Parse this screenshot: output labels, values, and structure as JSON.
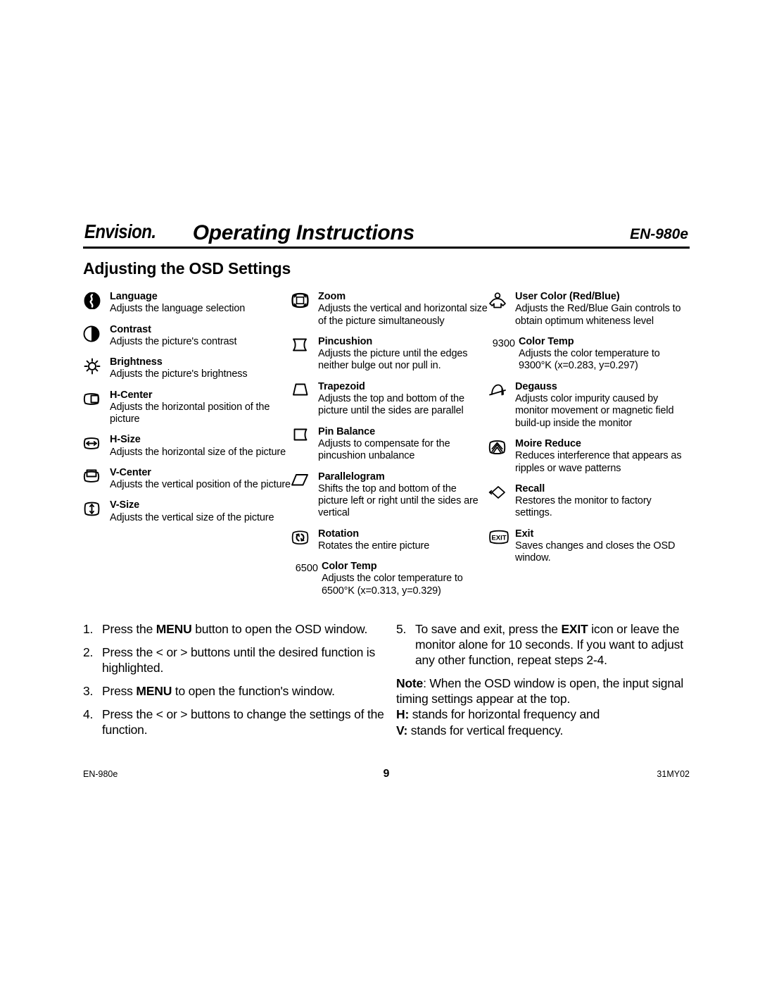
{
  "header": {
    "logo": "Envision",
    "title": "Operating Instructions",
    "model": "EN-980e"
  },
  "section_title": "Adjusting the OSD Settings",
  "columns": [
    {
      "id": "column-1",
      "entries": [
        {
          "icon": "language-globe-icon",
          "title": "Language",
          "desc": "Adjusts the language selection"
        },
        {
          "icon": "contrast-half-circle-icon",
          "title": "Contrast",
          "desc": "Adjusts the picture's contrast"
        },
        {
          "icon": "brightness-sun-icon",
          "title": "Brightness",
          "desc": "Adjusts the picture's brightness"
        },
        {
          "icon": "h-center-icon",
          "title": "H-Center",
          "desc": "Adjusts the horizontal position of the picture"
        },
        {
          "icon": "h-size-icon",
          "title": "H-Size",
          "desc": "Adjusts the horizontal size of the picture"
        },
        {
          "icon": "v-center-icon",
          "title": "V-Center",
          "desc": "Adjusts the vertical position of the picture"
        },
        {
          "icon": "v-size-icon",
          "title": "V-Size",
          "desc": "Adjusts the vertical size of the picture"
        }
      ]
    },
    {
      "id": "column-2",
      "entries": [
        {
          "icon": "zoom-icon",
          "title": "Zoom",
          "desc": "Adjusts the vertical and horizontal size of the picture simultaneously"
        },
        {
          "icon": "pincushion-icon",
          "title": "Pincushion",
          "desc": "Adjusts the picture until the edges neither bulge out nor pull in."
        },
        {
          "icon": "trapezoid-icon",
          "title": "Trapezoid",
          "desc": "Adjusts the top and bottom of the picture until the sides are parallel"
        },
        {
          "icon": "pin-balance-icon",
          "title": "Pin Balance",
          "desc": "Adjusts to compensate for the pincushion unbalance"
        },
        {
          "icon": "parallelogram-icon",
          "title": "Parallelogram",
          "desc": "Shifts the top and bottom of the picture left or right until the sides  are vertical"
        },
        {
          "icon": "rotation-icon",
          "title": "Rotation",
          "desc": "Rotates the entire picture"
        },
        {
          "icon": "color-temp-6500-label",
          "icon_text": "6500",
          "title": "Color Temp",
          "desc": "Adjusts the color temperature to 6500°K (x=0.313, y=0.329)"
        }
      ]
    },
    {
      "id": "column-3",
      "entries": [
        {
          "icon": "user-color-person-icon",
          "title": "User Color (Red/Blue)",
          "desc": "Adjusts the Red/Blue Gain controls to obtain optimum whiteness level"
        },
        {
          "icon": "color-temp-9300-label",
          "icon_text": "9300",
          "title": "Color Temp",
          "desc": "Adjusts the color temperature to 9300°K (x=0.283, y=0.297)"
        },
        {
          "icon": "degauss-icon",
          "title": "Degauss",
          "desc": "Adjusts color impurity caused by monitor movement or magnetic field build-up inside the monitor"
        },
        {
          "icon": "moire-reduce-icon",
          "title": "Moire Reduce",
          "desc": "Reduces interference that appears as ripples or wave patterns"
        },
        {
          "icon": "recall-diamond-icon",
          "title": "Recall",
          "desc": "Restores the monitor to factory settings."
        },
        {
          "icon": "exit-icon",
          "icon_text": "EXIT",
          "title": "Exit",
          "desc": "Saves changes and closes the OSD window."
        }
      ]
    }
  ],
  "steps_left": [
    {
      "num": "1.",
      "parts": [
        {
          "t": "Press the ",
          "b": false
        },
        {
          "t": "MENU",
          "b": true
        },
        {
          "t": " button to open the OSD window.",
          "b": false
        }
      ]
    },
    {
      "num": "2.",
      "parts": [
        {
          "t": "Press the < or > buttons until the desired function is highlighted.",
          "b": false
        }
      ]
    },
    {
      "num": "3.",
      "parts": [
        {
          "t": "Press ",
          "b": false
        },
        {
          "t": "MENU",
          "b": true
        },
        {
          "t": " to open the function's window.",
          "b": false
        }
      ]
    },
    {
      "num": "4.",
      "parts": [
        {
          "t": "Press the < or > buttons to change the settings of the function.",
          "b": false
        }
      ]
    }
  ],
  "steps_right": [
    {
      "num": "5.",
      "parts": [
        {
          "t": "To save and exit, press the ",
          "b": false
        },
        {
          "t": "EXIT",
          "b": true
        },
        {
          "t": " icon or leave the monitor alone for 10 seconds. If you want to adjust any other function, repeat steps 2-4.",
          "b": false
        }
      ]
    }
  ],
  "note": {
    "lines": [
      [
        {
          "t": "Note",
          "b": true
        },
        {
          "t": ": When the OSD window is open, the input signal timing settings appear at the top.",
          "b": false
        }
      ],
      [
        {
          "t": "H:",
          "b": true
        },
        {
          "t": " stands for horizontal frequency and",
          "b": false
        }
      ],
      [
        {
          "t": "V:",
          "b": true
        },
        {
          "t": " stands for vertical frequency.",
          "b": false
        }
      ]
    ]
  },
  "footer": {
    "left": "EN-980e",
    "page": "9",
    "right": "31MY02"
  }
}
